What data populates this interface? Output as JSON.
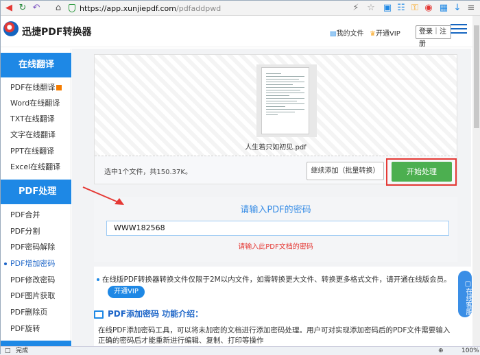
{
  "browser": {
    "url_host": "https://app.xunjiepdf.com",
    "url_path": "/pdfaddpwd",
    "status": "完成",
    "zoom": "100%"
  },
  "header": {
    "brand": "迅捷PDF转换器",
    "my_files": "我的文件",
    "vip": "开通VIP",
    "login": "登录｜注册"
  },
  "sidebar": {
    "section1": "在线翻译",
    "section1_items": [
      "PDF在线翻译",
      "Word在线翻译",
      "TXT在线翻译",
      "文字在线翻译",
      "PPT在线翻译",
      "Excel在线翻译"
    ],
    "section2": "PDF处理",
    "section2_items": [
      "PDF合并",
      "PDF分割",
      "PDF密码解除",
      "PDF增加密码",
      "PDF修改密码",
      "PDF图片获取",
      "PDF删除页",
      "PDF旋转"
    ]
  },
  "upload": {
    "filename": "人生若只如初见.pdf",
    "selected": "选中1个文件，共150.37K。",
    "continue_btn": "继续添加（批量转换）",
    "start_btn": "开始处理"
  },
  "password": {
    "title": "请输入PDF的密码",
    "value": "WWW182568",
    "hint": "请输入此PDF文档的密码"
  },
  "info": {
    "notice": "在线版PDF转换器转换文件仅限于2M以内文件，如需转换更大文件、转换更多格式文件，请开通在线版会员。",
    "vip_btn": "开通VIP",
    "intro_title": "PDF添加密码 功能介绍：",
    "intro_text": "在线PDF添加密码工具，可以将未加密的文档进行添加密码处理。用户可对实现添加密码后的PDF文件需要输入正确的密码后才能重新进行编辑、复制、打印等操作"
  },
  "service": "在线客服",
  "colors": {
    "accent": "#1e88e5",
    "start": "#4caf50",
    "highlight": "#e53935"
  }
}
